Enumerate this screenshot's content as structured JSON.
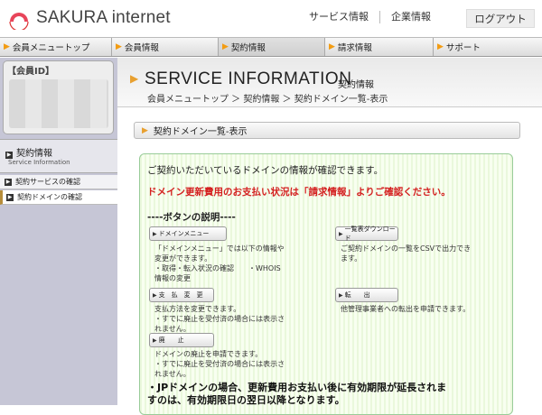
{
  "header": {
    "brand": "SAKURA internet",
    "links": [
      "サービス情報",
      "企業情報"
    ],
    "logout_label": "ログアウト"
  },
  "nav": {
    "items": [
      "会員メニュートップ",
      "会員情報",
      "契約情報",
      "請求情報",
      "サポート"
    ],
    "active_index": 2
  },
  "sidebar": {
    "member_label": "【会員ID】",
    "section_title": "契約情報",
    "section_subtitle": "Service Information",
    "links": [
      "契約サービスの確認",
      "契約ドメインの確認"
    ]
  },
  "main": {
    "title": "SERVICE INFORMATION",
    "title_sub": "契約情報",
    "breadcrumb": "会員メニュートップ ＞ 契約情報 ＞ 契約ドメイン一覧-表示",
    "section_title": "契約ドメイン一覧-表示",
    "intro": "ご契約いただいているドメインの情報が確認できます。",
    "warning": "ドメイン更新費用のお支払い状況は「請求情報」よりご確認ください。",
    "button_heading": "----ボタンの説明----",
    "buttons": [
      {
        "label": "ドメインメニュー",
        "desc": "「ドメインメニュー」では以下の情報や\n変更ができます。\n・取得・転入状況の確認　　・WHOIS\n情報の変更"
      },
      {
        "label": "一覧表ダウンロード",
        "desc": "ご契約ドメインの一覧をCSVで出力でき\nます。"
      },
      {
        "label": "支　払　変　更",
        "desc": "支払方法を変更できます。\n・すでに廃止を受付済の場合には表示さ\nれません。"
      },
      {
        "label": "転　　出",
        "desc": "他管理事業者への転出を申請できます。"
      },
      {
        "label": "廃　　止",
        "desc": "ドメインの廃止を申請できます。\n・すでに廃止を受付済の場合には表示さ\nれません。"
      }
    ],
    "bottom_note": "・JPドメインの場合、更新費用お支払い後に有効期限が延長されますのは、有効期限日の翌日以降となります。"
  }
}
